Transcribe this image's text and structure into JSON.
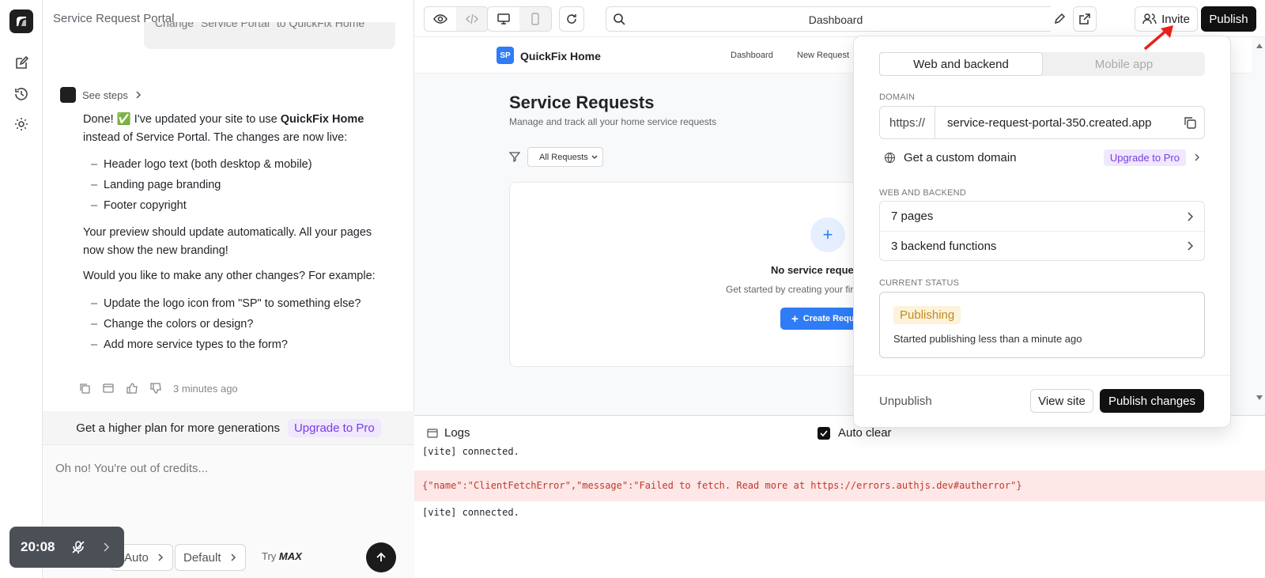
{
  "rail": {
    "icons": [
      "app-logo",
      "edit-icon",
      "history-icon",
      "settings-icon"
    ]
  },
  "chat": {
    "title": "Service Request Portal",
    "user_message": "Change \"Service Portal\" to QuickFix Home",
    "see_steps": "See steps",
    "reply": {
      "intro_a": "Done! ✅ I've updated your site to use ",
      "intro_bold": "QuickFix Home",
      "intro_b": " instead of Service Portal. The changes are now live:",
      "changes": [
        "Header logo text (both desktop & mobile)",
        "Landing page branding",
        "Footer copyright"
      ],
      "para2": "Your preview should update automatically. All your pages now show the new branding!",
      "para3": "Would you like to make any other changes? For example:",
      "suggestions": [
        "Update the logo icon from \"SP\" to something else?",
        "Change the colors or design?",
        "Add more service types to the form?"
      ]
    },
    "timestamp": "3 minutes ago",
    "upsell_text": "Get a higher plan for more generations",
    "upsell_link": "Upgrade to Pro",
    "composer_placeholder": "Oh no! You're out of credits...",
    "chip_auto": "Auto",
    "chip_default": "Default",
    "try_label": "Try",
    "try_max": "MAX"
  },
  "timer": {
    "time": "20:08"
  },
  "topbar": {
    "search_value": "Dashboard",
    "invite": "Invite",
    "publish": "Publish"
  },
  "preview": {
    "logo_initials": "SP",
    "brand": "QuickFix Home",
    "nav": [
      "Dashboard",
      "New Request"
    ],
    "title": "Service Requests",
    "subtitle": "Manage and track all your home service requests",
    "filter_value": "All Requests",
    "empty_title": "No service requests",
    "empty_sub": "Get started by creating your first",
    "create_btn": "Create Request"
  },
  "logs": {
    "title": "Logs",
    "auto_clear": "Auto clear",
    "lines": [
      "[vite] connected.",
      "{\"name\":\"ClientFetchError\",\"message\":\"Failed to fetch. Read more at https://errors.authjs.dev#autherror\"}",
      "[vite] connected."
    ]
  },
  "publish_panel": {
    "tab_web": "Web and backend",
    "tab_mobile": "Mobile app",
    "domain_label": "DOMAIN",
    "domain_prefix": "https://",
    "domain_value": "service-request-portal-350.created.app",
    "custom_domain": "Get a custom domain",
    "upgrade": "Upgrade to Pro",
    "section_label": "WEB AND BACKEND",
    "pages": "7 pages",
    "functions": "3 backend functions",
    "status_label": "CURRENT STATUS",
    "status_badge": "Publishing",
    "status_text": "Started publishing less than a minute ago",
    "unpublish": "Unpublish",
    "view_site": "View site",
    "publish_changes": "Publish changes"
  },
  "colors": {
    "accent": "#2f7cf6",
    "pro": "#7a3de0",
    "publishing": "#c08a1a",
    "error_bg": "#fde7e7"
  }
}
